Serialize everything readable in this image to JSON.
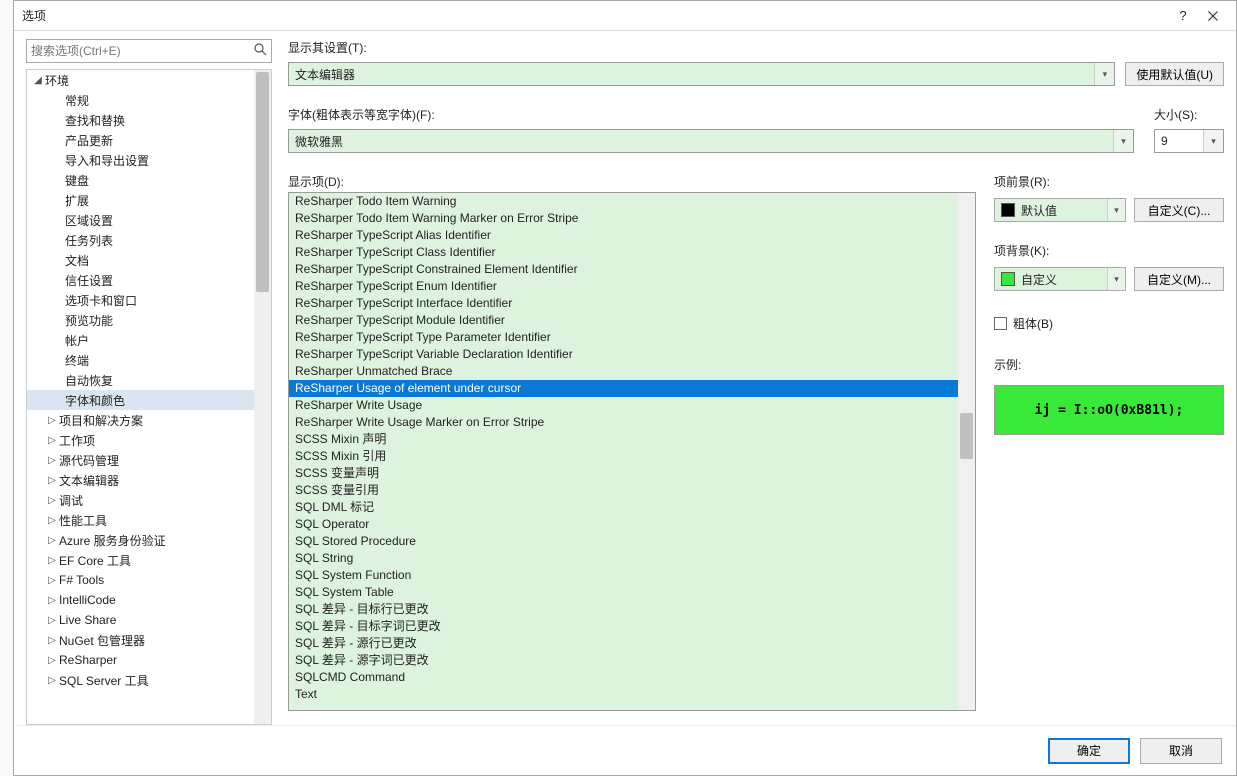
{
  "window": {
    "title": "选项"
  },
  "search": {
    "placeholder": "搜索选项(Ctrl+E)"
  },
  "tree": {
    "root": {
      "label": "环境",
      "children": [
        "常规",
        "查找和替换",
        "产品更新",
        "导入和导出设置",
        "键盘",
        "扩展",
        "区域设置",
        "任务列表",
        "文档",
        "信任设置",
        "选项卡和窗口",
        "预览功能",
        "帐户",
        "终端",
        "自动恢复",
        "字体和颜色"
      ],
      "selected": "字体和颜色"
    },
    "collapsed": [
      "项目和解决方案",
      "工作项",
      "源代码管理",
      "文本编辑器",
      "调试",
      "性能工具",
      "Azure 服务身份验证",
      "EF Core 工具",
      "F# Tools",
      "IntelliCode",
      "Live Share",
      "NuGet 包管理器",
      "ReSharper",
      "SQL Server 工具"
    ]
  },
  "labels": {
    "showSettingsFor": "显示其设置(T):",
    "useDefaults": "使用默认值(U)",
    "fontLabel": "字体(粗体表示等宽字体)(F):",
    "sizeLabel": "大小(S):",
    "displayItems": "显示项(D):",
    "itemForeground": "项前景(R):",
    "itemBackground": "项背景(K):",
    "custom1": "自定义(C)...",
    "custom2": "自定义(M)...",
    "bold": "粗体(B)",
    "sample": "示例:",
    "ok": "确定",
    "cancel": "取消"
  },
  "values": {
    "showSettingsFor": "文本编辑器",
    "font": "微软雅黑",
    "size": "9",
    "foreground": {
      "label": "默认值",
      "color": "#000000"
    },
    "background": {
      "label": "自定义",
      "color": "#39e93a"
    },
    "boldChecked": false,
    "sampleText": "ij = I::oO(0xB81l);"
  },
  "displayItems": [
    "ReSharper Todo Item Warning",
    "ReSharper Todo Item Warning Marker on Error Stripe",
    "ReSharper TypeScript Alias Identifier",
    "ReSharper TypeScript Class Identifier",
    "ReSharper TypeScript Constrained Element Identifier",
    "ReSharper TypeScript Enum Identifier",
    "ReSharper TypeScript Interface Identifier",
    "ReSharper TypeScript Module Identifier",
    "ReSharper TypeScript Type Parameter Identifier",
    "ReSharper TypeScript Variable Declaration Identifier",
    "ReSharper Unmatched Brace",
    "ReSharper Usage of element under cursor",
    "ReSharper Write Usage",
    "ReSharper Write Usage Marker on Error Stripe",
    "SCSS Mixin 声明",
    "SCSS Mixin 引用",
    "SCSS 变量声明",
    "SCSS 变量引用",
    "SQL DML 标记",
    "SQL Operator",
    "SQL Stored Procedure",
    "SQL String",
    "SQL System Function",
    "SQL System Table",
    "SQL 差异 - 目标行已更改",
    "SQL 差异 - 目标字词已更改",
    "SQL 差异 - 源行已更改",
    "SQL 差异 - 源字词已更改",
    "SQLCMD Command",
    "Text"
  ],
  "selectedDisplayItem": "ReSharper Usage of element under cursor"
}
